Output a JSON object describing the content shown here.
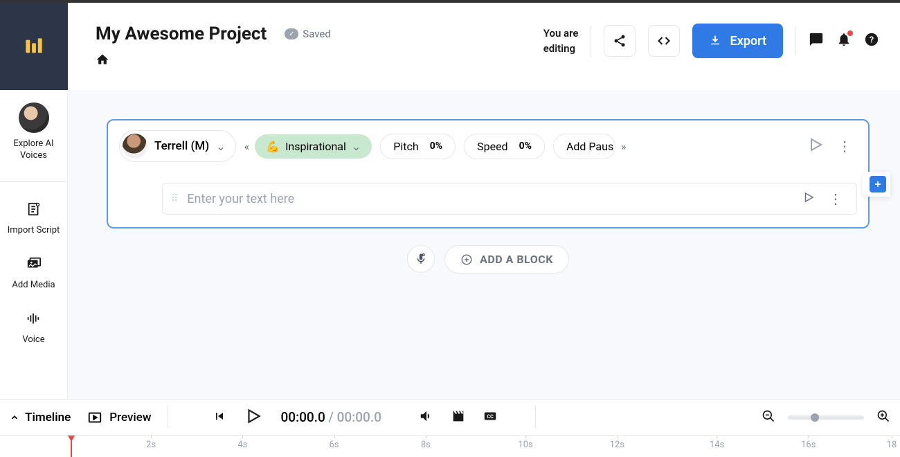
{
  "header": {
    "project_title": "My Awesome Project",
    "saved_label": "Saved",
    "editing_line1": "You are",
    "editing_line2": "editing",
    "export_label": "Export"
  },
  "sidebar": {
    "explore_label": "Explore AI Voices",
    "import_label": "Import Script",
    "media_label": "Add Media",
    "voice_label": "Voice"
  },
  "block": {
    "voice_name": "Terrell (M)",
    "style_emoji": "💪",
    "style_label": "Inspirational",
    "pitch_label": "Pitch",
    "pitch_value": "0%",
    "speed_label": "Speed",
    "speed_value": "0%",
    "pause_label": "Add Paus",
    "text_placeholder": "Enter your text here"
  },
  "actions": {
    "add_block_label": "ADD A BLOCK"
  },
  "timeline": {
    "toggle_label": "Timeline",
    "preview_label": "Preview",
    "time_current": "00:00.0",
    "time_separator": " / ",
    "time_total": "00:00.0",
    "ticks": [
      "2s",
      "4s",
      "6s",
      "8s",
      "10s",
      "12s",
      "14s",
      "16s",
      "18"
    ]
  }
}
